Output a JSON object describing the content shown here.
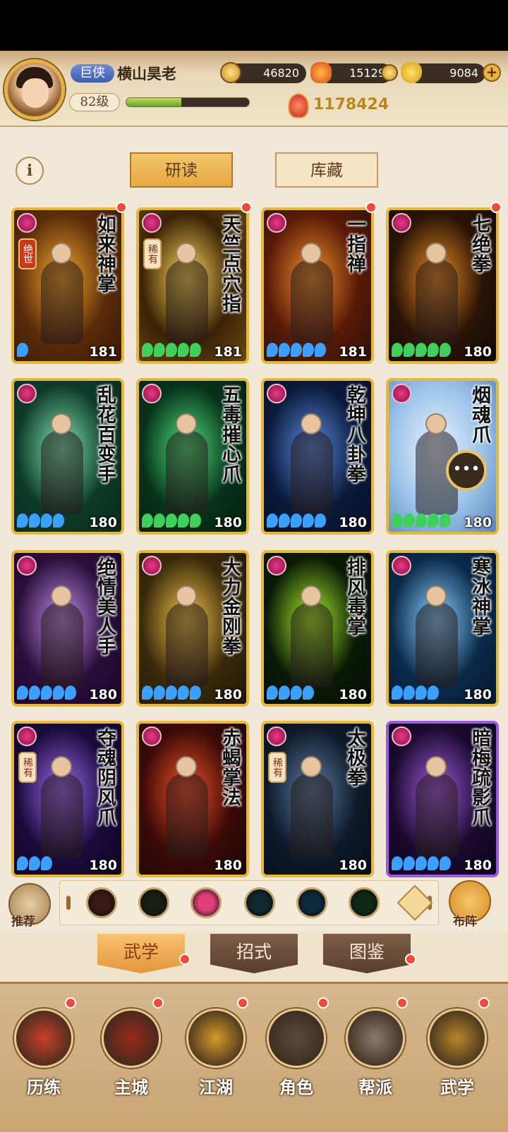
{
  "header": {
    "title_badge": "巨侠",
    "player_name": "横山昊老",
    "level": "82级",
    "exp_fraction": 0.45,
    "coins": "46820",
    "fire_currency": "15129",
    "ingots": "9084",
    "plus": "+",
    "power": "1178424"
  },
  "info_button": "i",
  "top_tabs": [
    {
      "label": "研读",
      "active": true
    },
    {
      "label": "库藏",
      "active": false
    }
  ],
  "cards": [
    {
      "name": "如来神掌",
      "level": "181",
      "stars": 1,
      "rarity": "绝世",
      "rarity_style": "red",
      "bg": [
        "#5a2c0a",
        "#f2a42a",
        "#3a1806"
      ],
      "frame": "gold",
      "star_color": "#3ba0ff"
    },
    {
      "name": "天竺点穴指",
      "level": "181",
      "stars": 5,
      "rarity": "稀有",
      "rarity_style": "normal",
      "bg": [
        "#3a2206",
        "#ffd65a",
        "#6a4a12"
      ],
      "frame": "gold",
      "star_color": "#3fcf5a"
    },
    {
      "name": "一指禅",
      "level": "181",
      "stars": 5,
      "rarity": "",
      "bg": [
        "#5a1a08",
        "#f0902a",
        "#2a1206"
      ],
      "frame": "gold",
      "star_color": "#3ba0ff"
    },
    {
      "name": "七绝拳",
      "level": "180",
      "stars": 5,
      "rarity": "",
      "bg": [
        "#2a1406",
        "#e88a22",
        "#140a04"
      ],
      "frame": "gold",
      "star_color": "#3fcf5a"
    },
    {
      "name": "乱花百变手",
      "level": "180",
      "stars": 4,
      "rarity": "",
      "bg": [
        "#0e3a2a",
        "#7ee2b2",
        "#0a2a1e"
      ],
      "frame": "gold",
      "star_color": "#3ba0ff"
    },
    {
      "name": "五毒摧心爪",
      "level": "180",
      "stars": 5,
      "rarity": "",
      "bg": [
        "#06321a",
        "#4ee07a",
        "#03200e"
      ],
      "frame": "gold",
      "star_color": "#3fcf5a"
    },
    {
      "name": "乾坤八卦拳",
      "level": "180",
      "stars": 5,
      "rarity": "",
      "bg": [
        "#0a1a3a",
        "#5a8ae0",
        "#06102a"
      ],
      "frame": "gold",
      "star_color": "#3ba0ff"
    },
    {
      "name": "烟魂爪",
      "level": "180",
      "stars": 5,
      "rarity": "",
      "bg": [
        "#9ac2e8",
        "#eaf4ff",
        "#5a86b8"
      ],
      "frame": "gold",
      "star_color": "#3fcf5a"
    },
    {
      "name": "绝情美人手",
      "level": "180",
      "stars": 5,
      "rarity": "",
      "bg": [
        "#2a0e3a",
        "#c08ae8",
        "#1a062a"
      ],
      "frame": "gold",
      "star_color": "#3ba0ff"
    },
    {
      "name": "大力金刚拳",
      "level": "180",
      "stars": 5,
      "rarity": "",
      "bg": [
        "#3a2a0a",
        "#f2c24a",
        "#221606"
      ],
      "frame": "gold",
      "star_color": "#3ba0ff"
    },
    {
      "name": "排风毒掌",
      "level": "180",
      "stars": 4,
      "rarity": "",
      "bg": [
        "#0a1a06",
        "#a8f02a",
        "#060e04"
      ],
      "frame": "gold",
      "star_color": "#3ba0ff"
    },
    {
      "name": "寒冰神掌",
      "level": "180",
      "stars": 4,
      "rarity": "",
      "bg": [
        "#0a2a4a",
        "#8ad0ff",
        "#06182e"
      ],
      "frame": "gold",
      "star_color": "#3ba0ff"
    },
    {
      "name": "夺魂阴风爪",
      "level": "180",
      "stars": 3,
      "rarity": "稀有",
      "rarity_style": "normal",
      "bg": [
        "#1a0a3a",
        "#9a6af0",
        "#0e0626"
      ],
      "frame": "gold",
      "star_color": "#3ba0ff"
    },
    {
      "name": "赤蝎掌法",
      "level": "180",
      "stars": 0,
      "rarity": "",
      "bg": [
        "#3a0a06",
        "#f0502a",
        "#1e0604"
      ],
      "frame": "gold",
      "star_color": "#3ba0ff"
    },
    {
      "name": "太极拳",
      "level": "180",
      "stars": 0,
      "rarity": "稀有",
      "rarity_style": "normal",
      "bg": [
        "#0e1a2a",
        "#5a7aa0",
        "#060e1a"
      ],
      "frame": "gold",
      "star_color": "#3ba0ff"
    },
    {
      "name": "暗梅疏影爪",
      "level": "180",
      "stars": 5,
      "rarity": "",
      "bg": [
        "#1a0a2e",
        "#a05ae0",
        "#0e0420"
      ],
      "frame": "purple",
      "star_color": "#3ba0ff"
    }
  ],
  "filters": [
    {
      "icon": "sword-icon",
      "color": "#3a1a14"
    },
    {
      "icon": "dagger-icon",
      "color": "#1a1f14"
    },
    {
      "icon": "fist-icon",
      "color": "#e0407a"
    },
    {
      "icon": "palm-icon",
      "color": "#0e2a30"
    },
    {
      "icon": "swirl-icon",
      "color": "#0e2a3a"
    },
    {
      "icon": "dragon-icon",
      "color": "#0e2a14"
    }
  ],
  "side": {
    "recommend": "推荐",
    "formation": "布阵"
  },
  "bottom_tabs": [
    {
      "label": "武学",
      "active": true
    },
    {
      "label": "招式",
      "active": false
    },
    {
      "label": "图鉴",
      "active": false
    }
  ],
  "nav": [
    {
      "label": "历练",
      "color": "#c8402a"
    },
    {
      "label": "主城",
      "color": "#9a2a1a"
    },
    {
      "label": "江湖",
      "color": "#d49a2a"
    },
    {
      "label": "角色",
      "color": "#5a4a3a"
    },
    {
      "label": "帮派",
      "color": "#8a7a6a"
    },
    {
      "label": "武学",
      "color": "#b8862a"
    }
  ],
  "colors": {
    "accent": "#e7a844",
    "card_frame": "#e4b93a",
    "red_dot": "#f04a3a"
  }
}
